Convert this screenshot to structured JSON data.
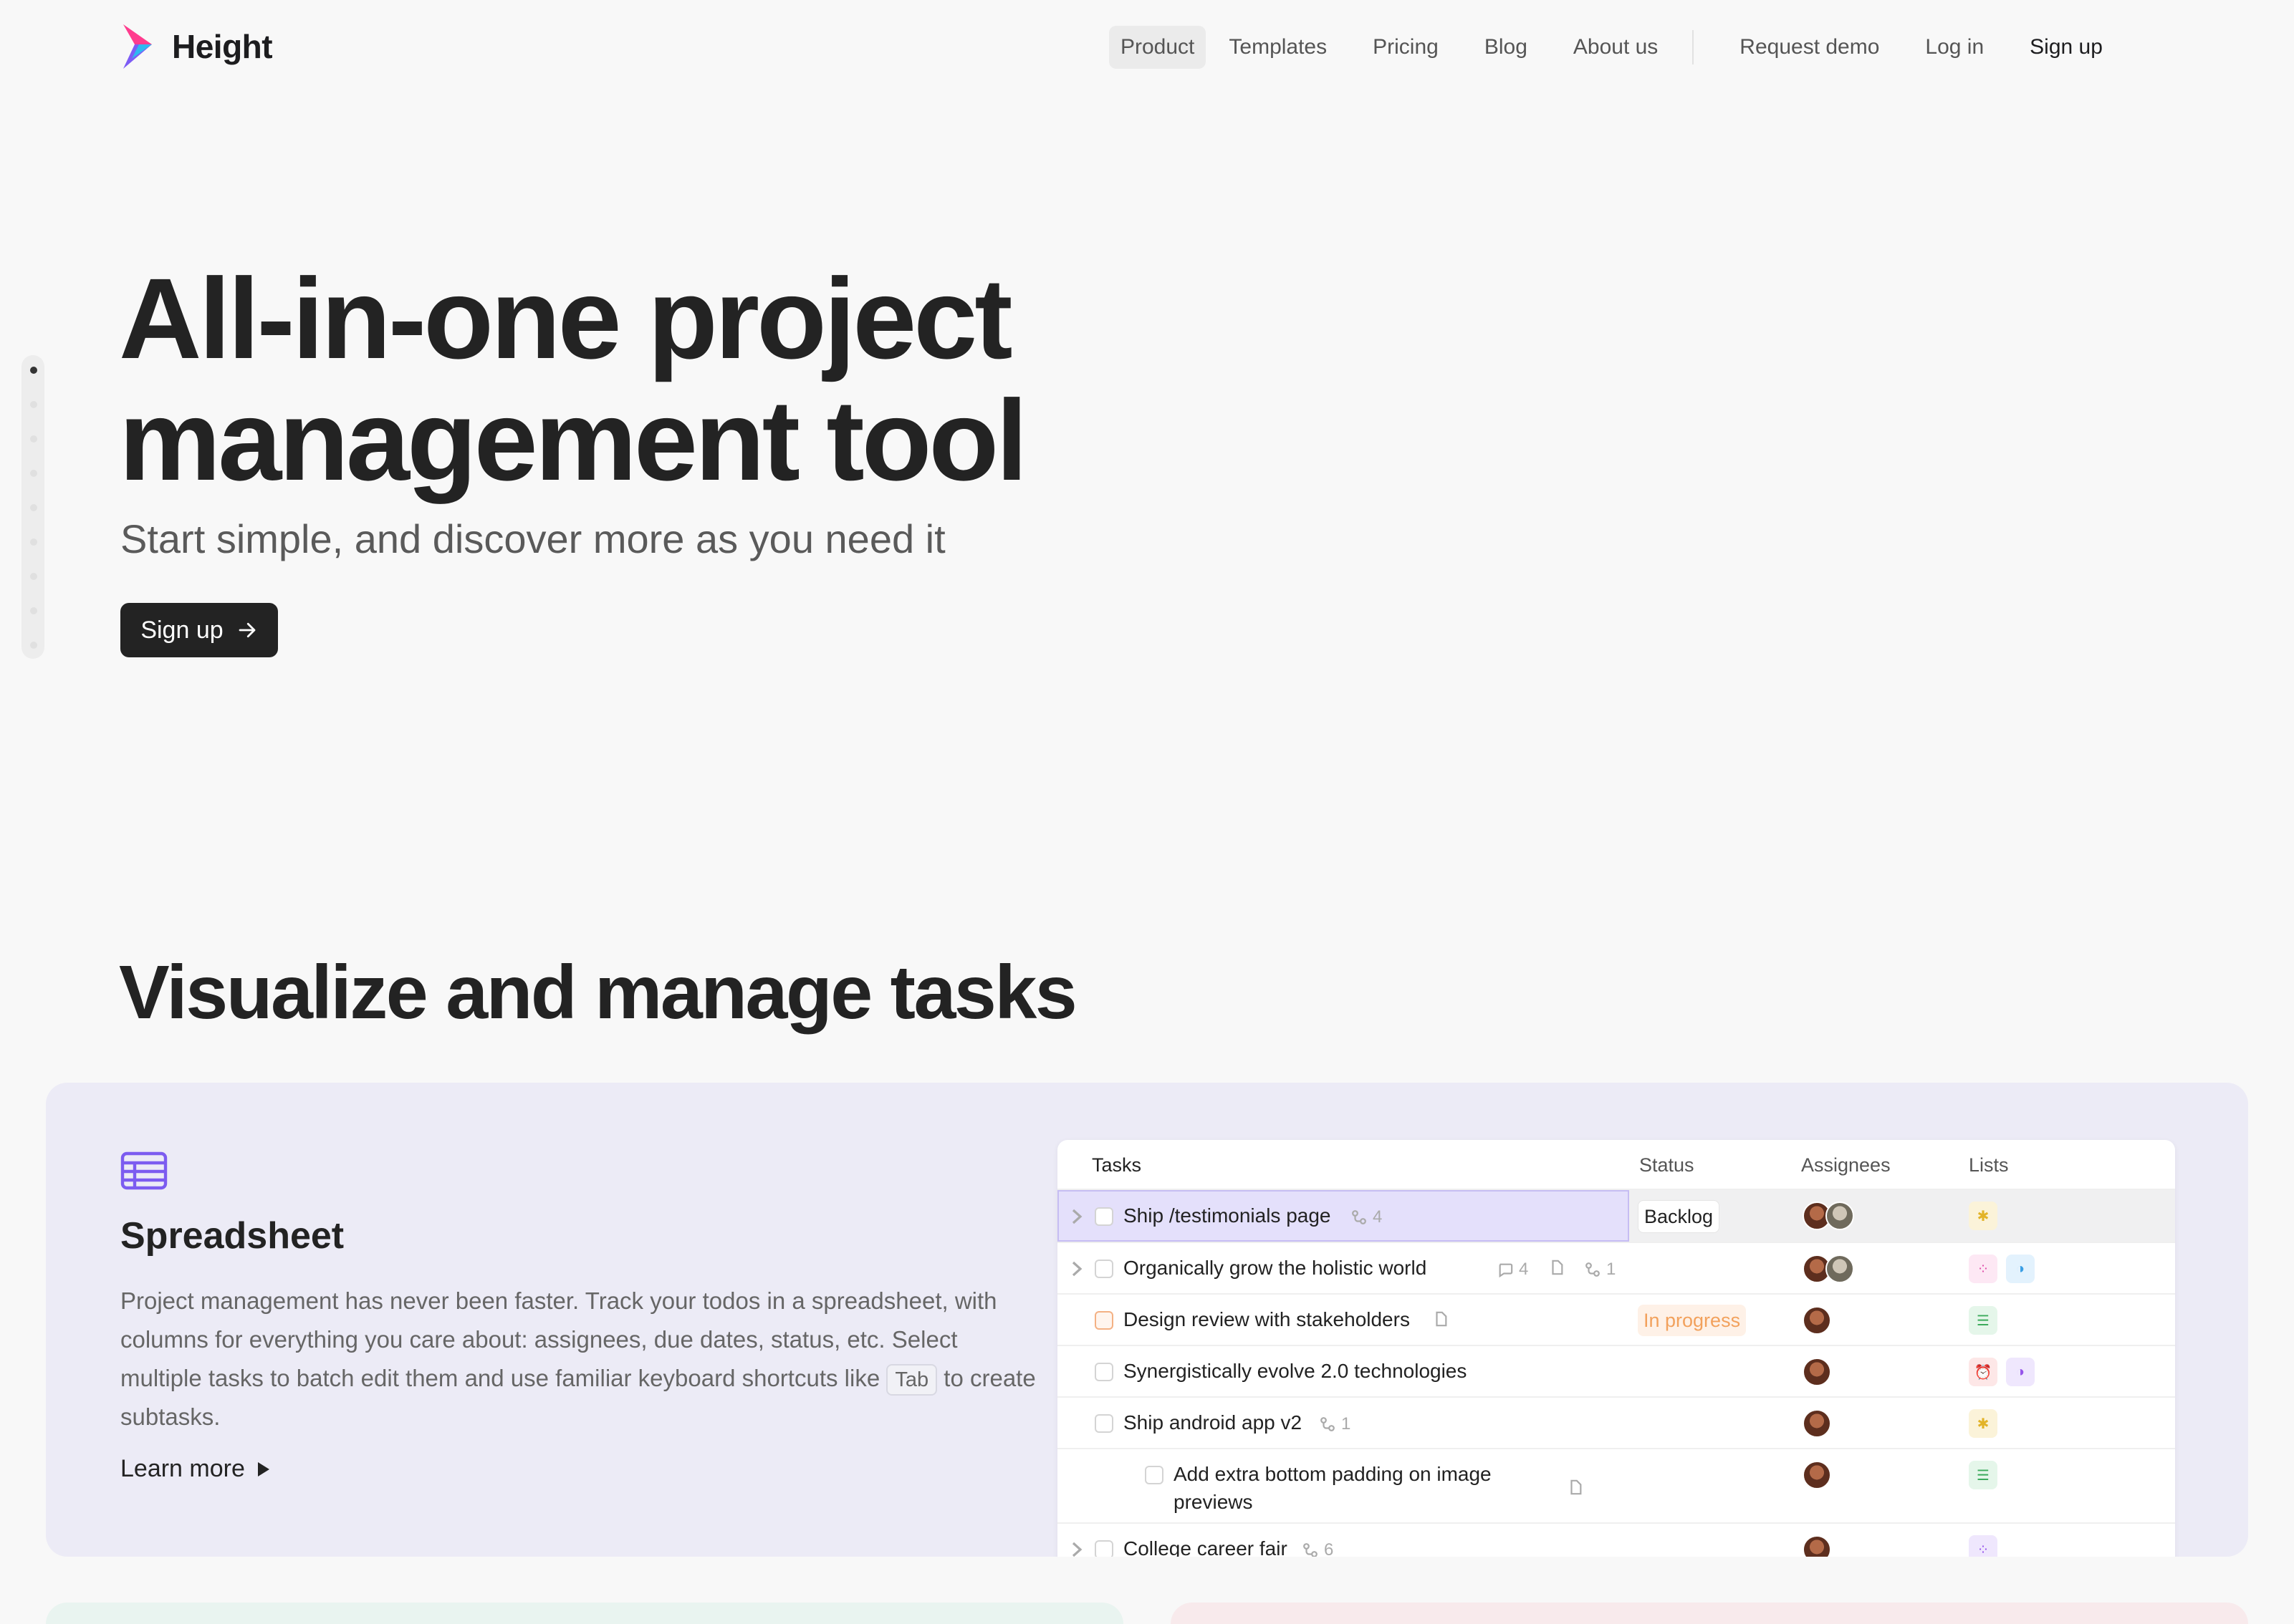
{
  "nav": {
    "logo_text": "Height",
    "links": [
      "Product",
      "Templates",
      "Pricing",
      "Blog",
      "About us"
    ],
    "request_demo": "Request demo",
    "log_in": "Log in",
    "sign_up": "Sign up"
  },
  "hero": {
    "title_line1": "All-in-one project",
    "title_line2": "management tool",
    "subtitle": "Start simple, and discover more as you need it",
    "cta": "Sign up"
  },
  "section": {
    "title": "Visualize and manage tasks"
  },
  "feature": {
    "title": "Spreadsheet",
    "desc_before": "Project management has never been faster. Track your todos in a spreadsheet, with columns for everything you care about: assignees, due dates, status, etc. Select multiple tasks to batch edit them and use familiar keyboard shortcuts like",
    "kbd": "Tab",
    "desc_after": "to create subtasks.",
    "learn_more": "Learn more"
  },
  "table": {
    "headers": {
      "tasks": "Tasks",
      "status": "Status",
      "assignees": "Assignees",
      "lists": "Lists"
    },
    "rows": [
      {
        "name": "Ship /testimonials page",
        "subtasks": "4",
        "status": "Backlog",
        "assignees": 2,
        "lists": [
          "bulb-icon"
        ]
      },
      {
        "name": "Organically grow the holistic world",
        "comments": "4",
        "subtasks": "1",
        "status": "",
        "assignees": 2,
        "lists": [
          "grid-icon",
          "half-circle-icon"
        ]
      },
      {
        "name": "Design review with stakeholders",
        "status": "In progress",
        "assignees": 1,
        "lists": [
          "stack-icon"
        ]
      },
      {
        "name": "Synergistically evolve 2.0 technologies",
        "status": "",
        "assignees": 1,
        "lists": [
          "alarm-icon",
          "half-circle-icon"
        ]
      },
      {
        "name": "Ship android app v2",
        "subtasks": "1",
        "status": "",
        "assignees": 1,
        "lists": [
          "bulb-icon"
        ]
      },
      {
        "name_line1": "Add extra bottom padding on image",
        "name_line2": "previews",
        "status": "",
        "assignees": 1,
        "lists": [
          "stack-icon"
        ]
      },
      {
        "name": "College career fair",
        "subtasks": "6",
        "status": "",
        "assignees": 1,
        "lists": [
          "grid-icon"
        ]
      }
    ]
  },
  "colors": {
    "accent_purple": "#7c5cf0",
    "card_bg": "#ecebf6",
    "status_progress": "#f2a15c"
  }
}
